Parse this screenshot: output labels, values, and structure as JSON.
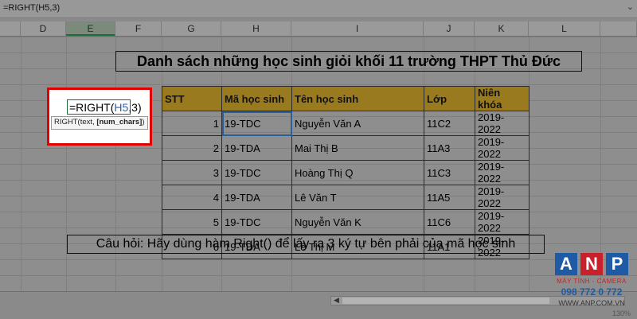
{
  "formula_bar": {
    "text": "=RIGHT(H5,3)"
  },
  "columns": [
    "D",
    "E",
    "F",
    "G",
    "H",
    "I",
    "J",
    "K",
    "L"
  ],
  "selected_column": "E",
  "title": "Danh sách những học sinh giỏi khối 11 trường THPT Thủ Đức",
  "table": {
    "headers": [
      "STT",
      "Mã học sinh",
      "Tên học sinh",
      "Lớp",
      "Niên khóa"
    ],
    "rows": [
      [
        "1",
        "19-TDC",
        "Nguyễn Văn A",
        "11C2",
        "2019-2022"
      ],
      [
        "2",
        "19-TDA",
        "Mai Thị B",
        "11A3",
        "2019-2022"
      ],
      [
        "3",
        "19-TDC",
        "Hoàng Thị Q",
        "11C3",
        "2019-2022"
      ],
      [
        "4",
        "19-TDA",
        "Lê Văn T",
        "11A5",
        "2019-2022"
      ],
      [
        "5",
        "19-TDC",
        "Nguyễn Văn K",
        "11C6",
        "2019-2022"
      ],
      [
        "6",
        "19-TDA",
        "Lê Thị M",
        "11A1",
        "2019-2022"
      ]
    ]
  },
  "edit_cell": {
    "prefix": "=RIGHT(",
    "ref": "H5",
    "suffix": ",3)"
  },
  "tooltip": {
    "fn": "RIGHT(text, ",
    "arg": "[num_chars]",
    "close": ")"
  },
  "question": "Câu hỏi: Hãy dùng hàm Right() để lấy ra 3 ký tự bên phải của mã học sinh",
  "zoom": "130%",
  "logo": {
    "letters": [
      "A",
      "N",
      "P"
    ],
    "letter_colors": [
      "#1f5aa6",
      "#c8212b",
      "#1f5aa6"
    ],
    "tagline": "MÁY TÍNH - CAMERA",
    "phone": "098 772 0 772",
    "website": "WWW.ANP.COM.VN"
  },
  "colors": {
    "header_fill": "#9a7a1e",
    "highlight_border": "#e00000",
    "selection": "#2a5f9e"
  }
}
